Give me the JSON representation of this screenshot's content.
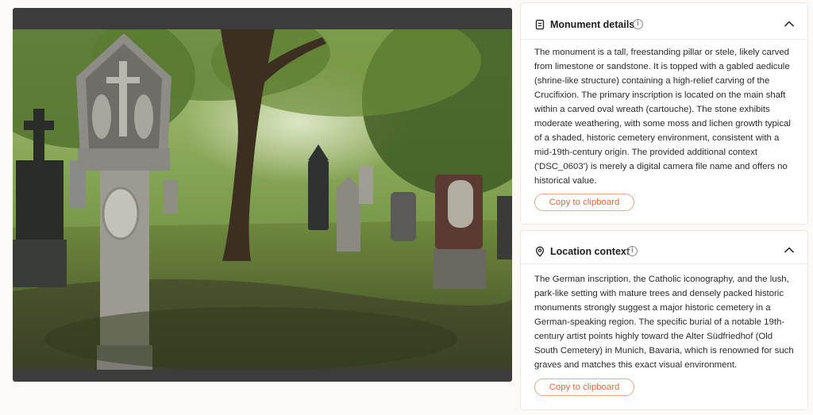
{
  "photo": {
    "alt": ""
  },
  "monument_card": {
    "title": "Monument details",
    "info_glyph": "i",
    "body": "The monument is a tall, freestanding pillar or stele, likely carved from limestone or sandstone. It is topped with a gabled aedicule (shrine-like structure) containing a high-relief carving of the Crucifixion. The primary inscription is located on the main shaft within a carved oval wreath (cartouche). The stone exhibits moderate weathering, with some moss and lichen growth typical of a shaded, historic cemetery environment, consistent with a mid-19th-century origin. The provided additional context ('DSC_0603') is merely a digital camera file name and offers no historical value.",
    "copy_label": "Copy to clipboard",
    "icon": "document-icon"
  },
  "location_card": {
    "title": "Location context",
    "info_glyph": "i",
    "body": "The German inscription, the Catholic iconography, and the lush, park-like setting with mature trees and densely packed historic monuments strongly suggest a major historic cemetery in a German-speaking region. The specific burial of a notable 19th-century artist points highly toward the Alter Südfriedhof (Old South Cemetery) in Munich, Bavaria, which is renowned for such graves and matches this exact visual environment.",
    "copy_label": "Copy to clipboard",
    "icon": "map-pin-icon"
  },
  "colors": {
    "page_bg": "#fdf9f6",
    "accent": "#e2683a",
    "accent_border": "#e8a98a",
    "frame": "#3c3c3c"
  }
}
